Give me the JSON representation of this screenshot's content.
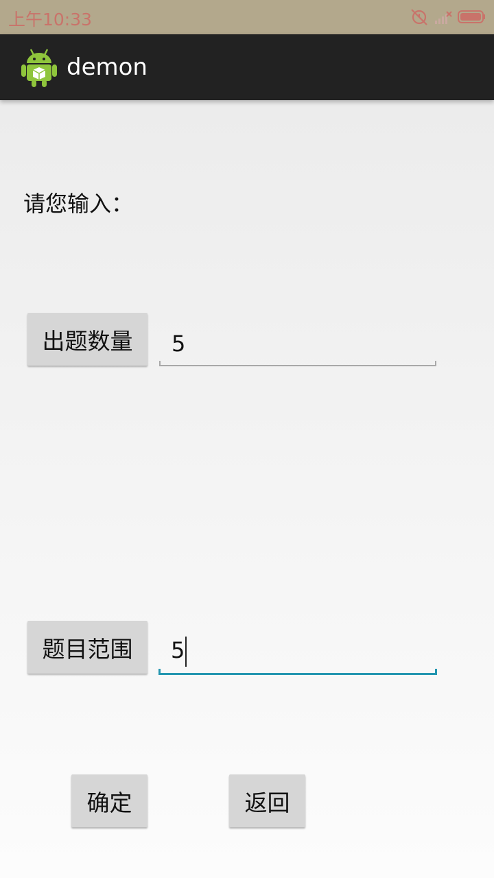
{
  "status_bar": {
    "time": "上午10:33",
    "icons": [
      "alarm-off-icon",
      "signal-icon",
      "battery-icon"
    ]
  },
  "action_bar": {
    "title": "demon",
    "icon": "android-icon"
  },
  "form": {
    "prompt": "请您输入：",
    "count_button": "出题数量",
    "count_value": "5",
    "range_button": "题目范围",
    "range_value": "5",
    "confirm_button": "确定",
    "back_button": "返回"
  },
  "colors": {
    "status_bar_bg": "#b3a88c",
    "action_bar_bg": "#222222",
    "accent": "#2496b0",
    "button_bg": "#d6d6d6"
  }
}
